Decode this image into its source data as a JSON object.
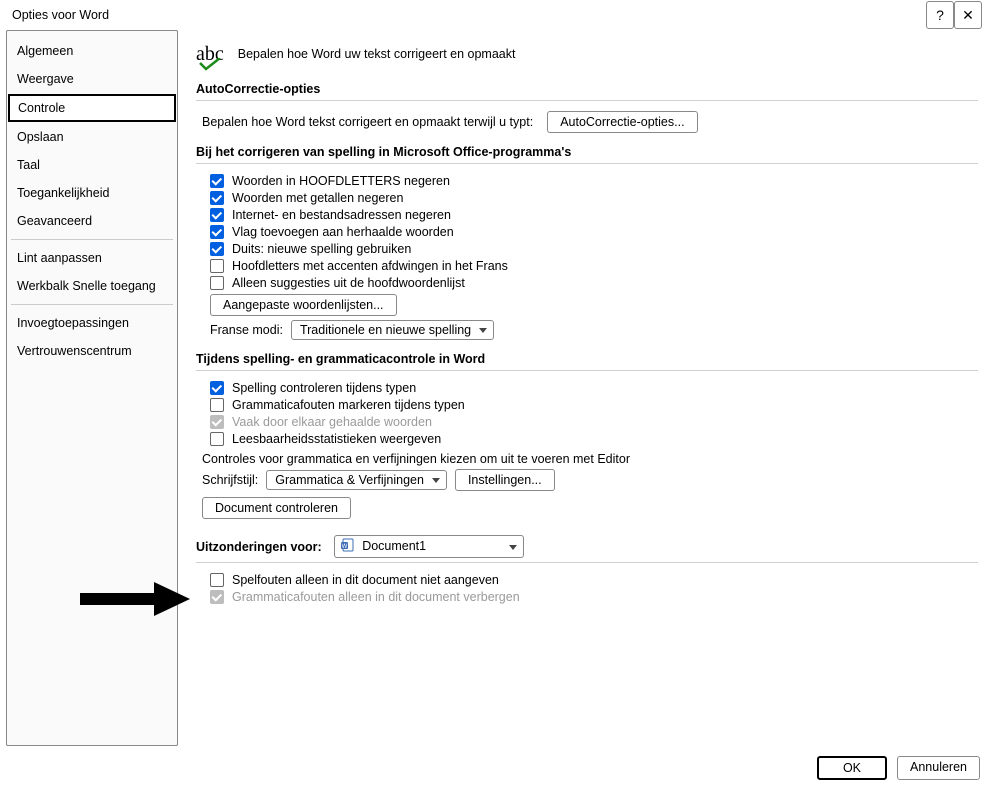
{
  "window": {
    "title": "Opties voor Word",
    "help_label": "?",
    "close_label": "✕"
  },
  "sidebar": {
    "items": [
      {
        "label": "Algemeen"
      },
      {
        "label": "Weergave"
      },
      {
        "label": "Controle",
        "selected": true
      },
      {
        "label": "Opslaan"
      },
      {
        "label": "Taal"
      },
      {
        "label": "Toegankelijkheid"
      },
      {
        "label": "Geavanceerd"
      },
      {
        "label": "Lint aanpassen"
      },
      {
        "label": "Werkbalk Snelle toegang"
      },
      {
        "label": "Invoegtoepassingen"
      },
      {
        "label": "Vertrouwenscentrum"
      }
    ]
  },
  "intro": {
    "glyph": "abc",
    "text": "Bepalen hoe Word uw tekst corrigeert en opmaakt"
  },
  "sections": {
    "autocorrect": {
      "title": "AutoCorrectie-opties",
      "desc": "Bepalen hoe Word tekst corrigeert en opmaakt terwijl u typt:",
      "button": "AutoCorrectie-opties..."
    },
    "spelling_office": {
      "title": "Bij het corrigeren van spelling in Microsoft Office-programma's",
      "chk_uppercase": "Woorden in HOOFDLETTERS negeren",
      "chk_numbers": "Woorden met getallen negeren",
      "chk_internet": "Internet- en bestandsadressen negeren",
      "chk_repeated": "Vlag toevoegen aan herhaalde woorden",
      "chk_german": "Duits: nieuwe spelling gebruiken",
      "chk_french_caps": "Hoofdletters met accenten afdwingen in het Frans",
      "chk_main_dict": "Alleen suggesties uit de hoofdwoordenlijst",
      "btn_custom_dict": "Aangepaste woordenlijsten...",
      "french_modes_label": "Franse modi:",
      "french_modes_value": "Traditionele en nieuwe spelling"
    },
    "spelling_word": {
      "title": "Tijdens spelling- en grammaticacontrole in Word",
      "chk_spell_typing": "Spelling controleren tijdens typen",
      "chk_grammar_typing": "Grammaticafouten markeren tijdens typen",
      "chk_confused": "Vaak door elkaar gehaalde woorden",
      "chk_readability": "Leesbaarheidsstatistieken weergeven",
      "editor_desc": "Controles voor grammatica en verfijningen kiezen om uit te voeren met Editor",
      "style_label": "Schrijfstijl:",
      "style_value": "Grammatica & Verfijningen",
      "btn_settings": "Instellingen...",
      "btn_check_doc": "Document controleren"
    },
    "exceptions": {
      "title": "Uitzonderingen voor:",
      "doc_value": "Document1",
      "chk_hide_spelling": "Spelfouten alleen in dit document niet aangeven",
      "chk_hide_grammar": "Grammaticafouten alleen in dit document verbergen"
    }
  },
  "footer": {
    "ok": "OK",
    "cancel": "Annuleren"
  }
}
